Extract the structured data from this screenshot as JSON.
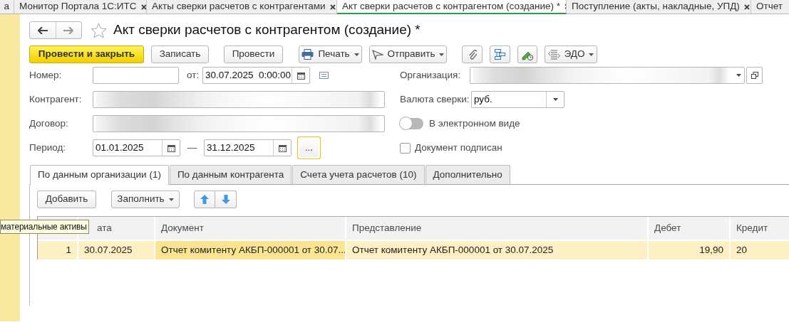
{
  "app_tabs": [
    {
      "label": "а",
      "selected": false
    },
    {
      "label": "Монитор Портала 1С:ИТС",
      "selected": false
    },
    {
      "label": "Акты сверки расчетов с контрагентами",
      "selected": false
    },
    {
      "label": "Акт сверки расчетов с контрагентом (создание) *",
      "selected": true
    },
    {
      "label": "Поступление (акты, накладные, УПД)",
      "selected": false
    },
    {
      "label": "Отчет",
      "selected": false
    }
  ],
  "form": {
    "title": "Акт сверки расчетов с контрагентом (создание) *"
  },
  "toolbar": {
    "post_close": "Провести и закрыть",
    "save": "Записать",
    "post": "Провести",
    "print": "Печать",
    "send": "Отправить",
    "edo": "ЭДО"
  },
  "fields": {
    "number_label": "Номер:",
    "date_label": "от:",
    "date": "30.07.2025  0:00:00",
    "organization_label": "Организация:",
    "counterparty_label": "Контрагент:",
    "contract_label": "Договор:",
    "currency_label": "Валюта сверки:",
    "currency": "руб.",
    "electronic": {
      "label": "В электронном виде",
      "on": false
    },
    "period_label": "Период:",
    "period_start": "01.01.2025",
    "period_separator": "—",
    "period_end": "31.12.2025",
    "period_button": "...",
    "signed": {
      "label": "Документ подписан",
      "checked": false
    }
  },
  "inner_tabs": [
    {
      "label": "По данным организации (1)",
      "selected": true
    },
    {
      "label": "По данным контрагента",
      "selected": false
    },
    {
      "label": "Счета учета расчетов (10)",
      "selected": false
    },
    {
      "label": "Дополнительно",
      "selected": false
    }
  ],
  "table_buttons": {
    "add": "Добавить",
    "fill": "Заполнить"
  },
  "table": {
    "columns": [
      "",
      "ата",
      "Документ",
      "Представление",
      "Дебет",
      "Кредит"
    ],
    "rows": [
      {
        "selected": true,
        "cells": [
          {
            "text": "1",
            "focused": false
          },
          {
            "text": "30.07.2025",
            "focused": false
          },
          {
            "text": "Отчет комитенту АКБП-000001 от 30.07...",
            "focused": true
          },
          {
            "text": "Отчет комитенту АКБП-000001 от 30.07.2025",
            "focused": false
          },
          {
            "text": "19,90",
            "focused": false
          },
          {
            "text": "20",
            "focused": false
          }
        ]
      }
    ]
  },
  "tooltip": {
    "text": "материальные активы"
  }
}
